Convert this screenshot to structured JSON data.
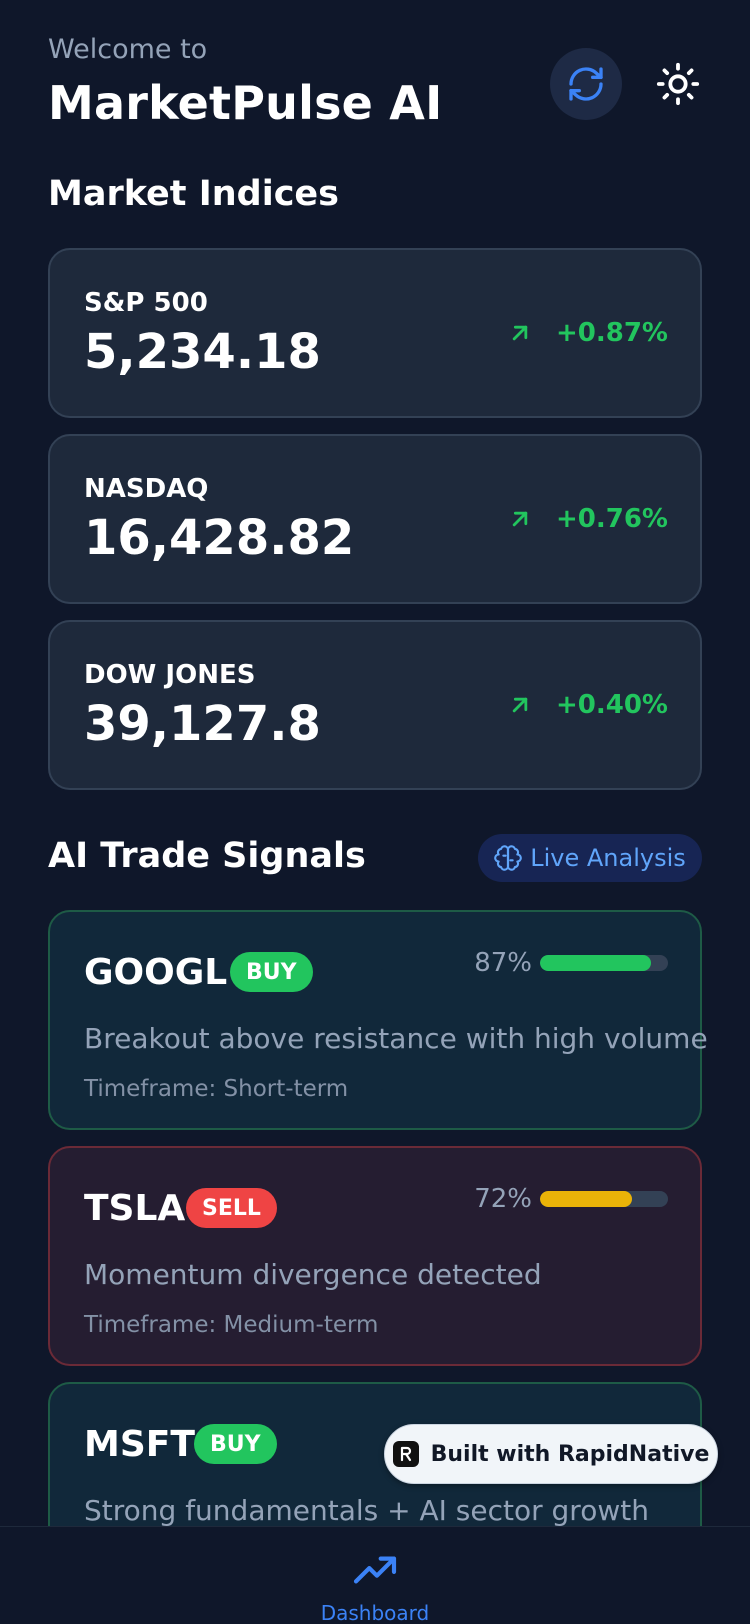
{
  "header": {
    "welcome": "Welcome to",
    "title": "MarketPulse AI"
  },
  "market_indices": {
    "title": "Market Indices",
    "items": [
      {
        "name": "S&P 500",
        "value": "5,234.18",
        "change": "+0.87%"
      },
      {
        "name": "NASDAQ",
        "value": "16,428.82",
        "change": "+0.76%"
      },
      {
        "name": "DOW JONES",
        "value": "39,127.8",
        "change": "+0.40%"
      }
    ]
  },
  "signals": {
    "title": "AI Trade Signals",
    "live_label": "Live Analysis",
    "items": [
      {
        "ticker": "GOOGL",
        "action": "BUY",
        "confidence": "87%",
        "confidence_value": 0.87,
        "bar_color": "#22c55e",
        "description": "Breakout above resistance with high volume",
        "timeframe": "Timeframe: Short-term"
      },
      {
        "ticker": "TSLA",
        "action": "SELL",
        "confidence": "72%",
        "confidence_value": 0.72,
        "bar_color": "#eab308",
        "description": "Momentum divergence detected",
        "timeframe": "Timeframe: Medium-term"
      },
      {
        "ticker": "MSFT",
        "action": "BUY",
        "description": "Strong fundamentals + AI sector growth"
      }
    ]
  },
  "built_with": "Built with RapidNative",
  "tabbar": {
    "dashboard_label": "Dashboard"
  },
  "icons": {
    "refresh": "refresh-icon",
    "theme": "sun-icon",
    "trend": "arrow-up-right-icon",
    "live": "brain-icon",
    "dashboard": "trending-up-icon"
  },
  "colors": {
    "background": "#0f172a",
    "card": "#1e293b",
    "positive": "#22c55e",
    "negative": "#ef4444",
    "accent": "#3b82f6"
  }
}
